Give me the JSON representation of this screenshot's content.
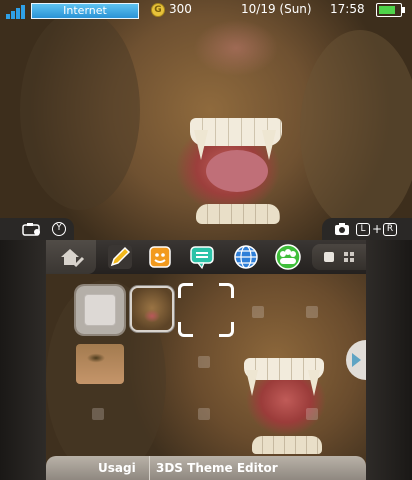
{
  "status_bar": {
    "connection_label": "Internet",
    "coin_symbol": "G",
    "coins": "300",
    "date": "10/19 (Sun)",
    "time": "17:58",
    "battery_level": 0.8,
    "signal_bars": 4
  },
  "top_hints": {
    "left_button": "Y",
    "right_button_l": "L",
    "right_plus": "+",
    "right_button_r": "R",
    "camera_icon": "camera-icon"
  },
  "toolbar": {
    "home_settings_icon": "home-settings-icon",
    "apps": [
      {
        "name": "notes-app",
        "icon": "pencil-icon",
        "color": "#f1b81c"
      },
      {
        "name": "friend-list-app",
        "icon": "smiley-icon",
        "color": "#f29a1e"
      },
      {
        "name": "notifications-app",
        "icon": "speech-bubble-icon",
        "color": "#2cc3a8"
      },
      {
        "name": "browser-app",
        "icon": "globe-icon",
        "color": "#2f7fd8"
      },
      {
        "name": "miiverse-app",
        "icon": "people-icon",
        "color": "#3fbe3b"
      }
    ],
    "view_toggle": [
      "single-view-icon",
      "grid-view-icon"
    ]
  },
  "name_bar": {
    "user": "Usagi",
    "title": "3DS Theme Editor"
  },
  "colors": {
    "accent_blue": "#2a93d6",
    "frame_dark": "#24211f"
  }
}
